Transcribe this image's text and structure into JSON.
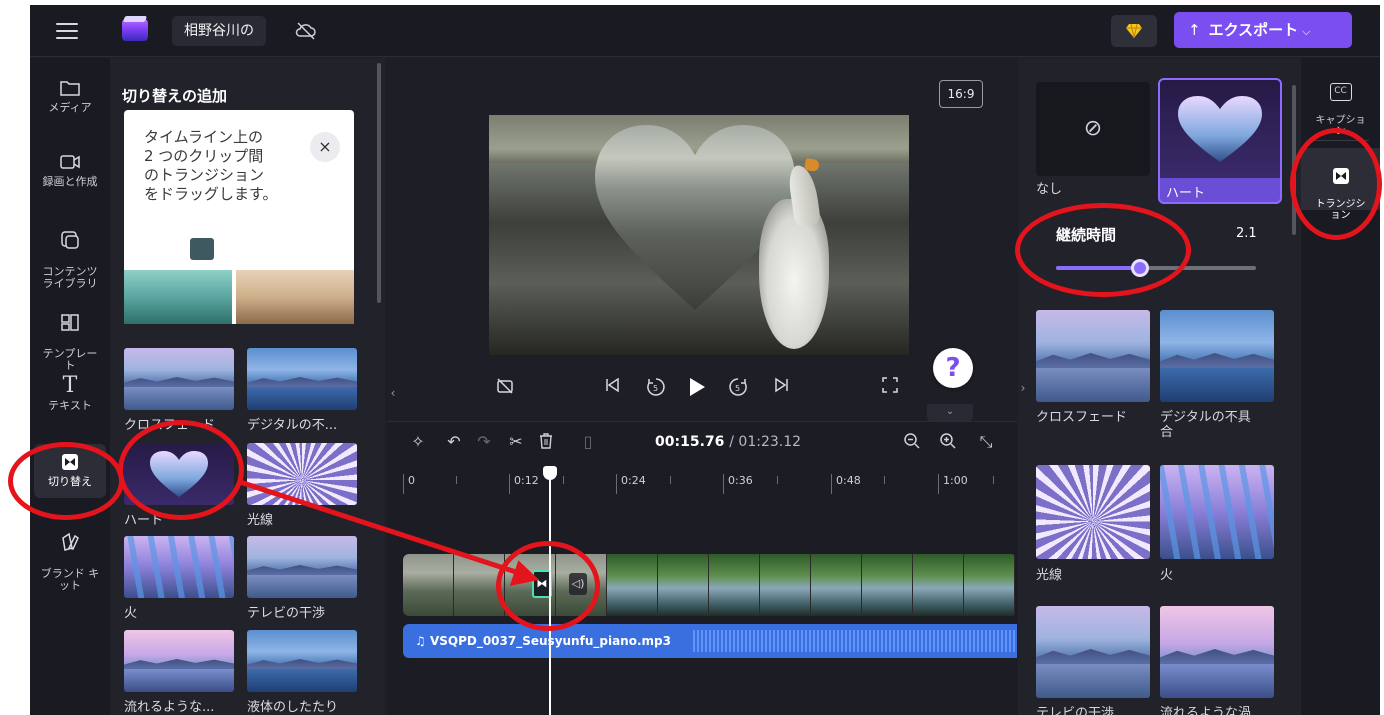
{
  "topbar": {
    "menu_icon": "hamburger-menu-icon",
    "project_title": "相野谷川の",
    "cloud_icon": "cloud-off-icon",
    "premium_icon": "diamond-icon",
    "export_label": "エクスポート",
    "export_icon": "upload-arrow-icon"
  },
  "leftnav": {
    "items": [
      {
        "label": "メディア",
        "icon": "folder-icon"
      },
      {
        "label": "録画と作成",
        "icon": "video-camera-icon"
      },
      {
        "label": "コンテンツ\nライブラリ",
        "icon": "content-library-icon"
      },
      {
        "label": "テンプレー\nト",
        "icon": "template-icon"
      },
      {
        "label": "テキスト",
        "icon": "text-icon"
      },
      {
        "label": "切り替え",
        "icon": "transition-icon"
      },
      {
        "label": "ブランド キ\nット",
        "icon": "brand-kit-icon"
      }
    ]
  },
  "transitions_panel": {
    "title": "切り替えの追加",
    "tip_text": "タイムライン上の\n2 つのクリップ間\nのトランジション\nをドラッグします。",
    "tip_close": "×",
    "items": [
      {
        "label": "クロスフェード"
      },
      {
        "label": "デジタルの不..."
      },
      {
        "label": "ハート"
      },
      {
        "label": "光線"
      },
      {
        "label": "火"
      },
      {
        "label": "テレビの干渉"
      },
      {
        "label": "流れるような..."
      },
      {
        "label": "液体のしたたり"
      }
    ]
  },
  "preview": {
    "aspect_ratio": "16:9",
    "help_label": "?"
  },
  "timeline": {
    "current_time": "00:15.76",
    "total_time": "/ 01:23.12",
    "ruler_ticks": [
      "0",
      "0:12",
      "0:24",
      "0:36",
      "0:48",
      "1:00"
    ],
    "audio_clip_name": "VSQPD_0037_Seusyunfu_piano.mp3",
    "playhead_position_seconds": 15.76
  },
  "properties_panel": {
    "none_label": "なし",
    "selected_label": "ハート",
    "duration_label": "継続時間",
    "duration_value": "2.1",
    "duration_slider_fraction": 0.42,
    "items": [
      {
        "label": "クロスフェード"
      },
      {
        "label": "デジタルの不具\n合"
      },
      {
        "label": "光線"
      },
      {
        "label": "火"
      },
      {
        "label": "テレビの干渉"
      },
      {
        "label": "流れるような渦"
      }
    ]
  },
  "right_rail": {
    "items": [
      {
        "label": "キャプショ\nン",
        "icon": "closed-captions-icon"
      },
      {
        "label": "トランジシ\nョン",
        "icon": "transition-icon"
      }
    ]
  },
  "colors": {
    "accent": "#7a4ef0",
    "annotation": "#e4141c",
    "audio_track": "#3a6fe0"
  }
}
